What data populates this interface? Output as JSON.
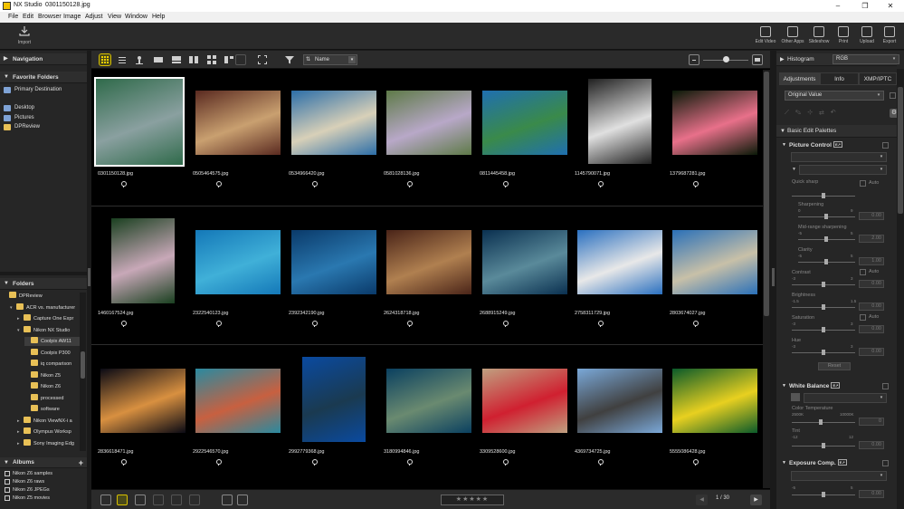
{
  "window": {
    "app_name": "NX Studio",
    "file_title": "0301150128.jpg",
    "controls": [
      "–",
      "❐",
      "✕"
    ]
  },
  "menu": [
    "File",
    "Edit",
    "Browser",
    "Image",
    "Adjust",
    "View",
    "Window",
    "Help"
  ],
  "toolbar": {
    "import_label": "Import",
    "right_buttons": [
      "Edit Video",
      "Other Apps",
      "Slideshow",
      "Print",
      "Upload",
      "Export"
    ]
  },
  "left_panel": {
    "navigation_title": "Navigation",
    "favorites_title": "Favorite Folders",
    "favorites": [
      "Primary Destination",
      "Desktop",
      "Pictures",
      "DPReview"
    ],
    "folders_title": "Folders",
    "folder_tree": [
      {
        "label": "DPReview",
        "indent": 0,
        "twisty": ""
      },
      {
        "label": "ACR vs. manufacturer",
        "indent": 1,
        "twisty": "▾"
      },
      {
        "label": "Capture One Expr",
        "indent": 2,
        "twisty": "▸"
      },
      {
        "label": "Nikon NX Studio",
        "indent": 2,
        "twisty": "▾"
      },
      {
        "label": "Coolpix AW11",
        "indent": 3,
        "twisty": "",
        "selected": true
      },
      {
        "label": "Coolpix P300",
        "indent": 3,
        "twisty": ""
      },
      {
        "label": "iq comparison",
        "indent": 3,
        "twisty": ""
      },
      {
        "label": "Nikon Z5",
        "indent": 3,
        "twisty": ""
      },
      {
        "label": "Nikon Z6",
        "indent": 3,
        "twisty": ""
      },
      {
        "label": "processed",
        "indent": 3,
        "twisty": ""
      },
      {
        "label": "software",
        "indent": 3,
        "twisty": ""
      },
      {
        "label": "Nikon ViewNX-i a",
        "indent": 2,
        "twisty": "▸"
      },
      {
        "label": "Olympus Worksp",
        "indent": 2,
        "twisty": "▸"
      },
      {
        "label": "Sony Imaging Edg",
        "indent": 2,
        "twisty": "▸"
      }
    ],
    "albums_title": "Albums",
    "albums": [
      "Nikon Z6 samples",
      "Nikon Z6 raws",
      "Nikon Z6 JPEGs",
      "Nikon Z5 movies"
    ]
  },
  "browser": {
    "sort_label": "Name",
    "thumbnails": [
      {
        "file": "0301150128.jpg",
        "c1": "#2f6a4a",
        "c2": "#8aa0a0",
        "selected": true
      },
      {
        "file": "0505464575.jpg",
        "c1": "#5a2a20",
        "c2": "#c9a070"
      },
      {
        "file": "0534966420.jpg",
        "c1": "#2c6ea8",
        "c2": "#d8d0b8"
      },
      {
        "file": "0581028136.jpg",
        "c1": "#5e7a48",
        "c2": "#b8a8c8"
      },
      {
        "file": "0811445458.jpg",
        "c1": "#1f6fb0",
        "c2": "#3a8a4a"
      },
      {
        "file": "1145790071.jpg",
        "c1": "#202020",
        "c2": "#e0e0e0",
        "portrait": true
      },
      {
        "file": "1379687281.jpg",
        "c1": "#0a1a08",
        "c2": "#e8708a"
      },
      {
        "file": "1460167524.jpg",
        "c1": "#1a4020",
        "c2": "#c8a8b8",
        "portrait": true
      },
      {
        "file": "2322540123.jpg",
        "c1": "#1478b8",
        "c2": "#40b0d8"
      },
      {
        "file": "2392342190.jpg",
        "c1": "#0a3a6a",
        "c2": "#2a78b0"
      },
      {
        "file": "2624318718.jpg",
        "c1": "#4a2418",
        "c2": "#b08050"
      },
      {
        "file": "2688915249.jpg",
        "c1": "#0a3050",
        "c2": "#5a8a9a"
      },
      {
        "file": "2758311729.jpg",
        "c1": "#2a70c0",
        "c2": "#e8e8e8"
      },
      {
        "file": "2803674027.jpg",
        "c1": "#2a70b8",
        "c2": "#c8c0a8"
      },
      {
        "file": "2836618471.jpg",
        "c1": "#0a0a14",
        "c2": "#d89040"
      },
      {
        "file": "2922546570.jpg",
        "c1": "#2a8aa0",
        "c2": "#c86040"
      },
      {
        "file": "2992779368.jpg",
        "c1": "#0a4aa0",
        "c2": "#1a3a50",
        "portrait": true
      },
      {
        "file": "3180994846.jpg",
        "c1": "#0a4060",
        "c2": "#6a8a70"
      },
      {
        "file": "3309528600.jpg",
        "c1": "#c0a080",
        "c2": "#d02030"
      },
      {
        "file": "4369734725.jpg",
        "c1": "#7aa8d8",
        "c2": "#404040"
      },
      {
        "file": "5555086428.jpg",
        "c1": "#0a5a2a",
        "c2": "#e8d020"
      }
    ],
    "page_indicator": "1 / 30",
    "stars": "★★★★★"
  },
  "right_panel": {
    "histogram_title": "Histogram",
    "histogram_mode": "RGB",
    "tabs": [
      "Adjustments",
      "Info",
      "XMP/IPTC"
    ],
    "version_select": "Original Value",
    "palettes_title": "Basic Edit Palettes",
    "picture_control": {
      "title": "Picture Control",
      "quick_sharp": "Quick sharp",
      "auto": "Auto",
      "sliders": [
        {
          "label": "Sharpening",
          "value": "0.00",
          "min": "0",
          "max": "9"
        },
        {
          "label": "Mid-range sharpening",
          "value": "2.00",
          "min": "-5",
          "max": "5"
        },
        {
          "label": "Clarity",
          "value": "1.00",
          "min": "-5",
          "max": "5"
        },
        {
          "label": "Contrast",
          "value": "0.00",
          "min": "-3",
          "max": "3"
        },
        {
          "label": "Brightness",
          "value": "0.00",
          "min": "-1.5",
          "max": "1.5"
        },
        {
          "label": "Saturation",
          "value": "0.00",
          "min": "-3",
          "max": "3"
        },
        {
          "label": "Hue",
          "value": "0.00",
          "min": "-3",
          "max": "3"
        }
      ],
      "reset": "Reset"
    },
    "white_balance": {
      "title": "White Balance",
      "color_temp": "Color Temperature",
      "ct_min": "2500K",
      "ct_max": "10000K",
      "ct_value": "0",
      "tint": "Tint",
      "tint_min": "-12",
      "tint_max": "12",
      "tint_value": "0.00"
    },
    "exposure": {
      "title": "Exposure Comp.",
      "min": "-5",
      "max": "5",
      "value": "0.00"
    }
  }
}
